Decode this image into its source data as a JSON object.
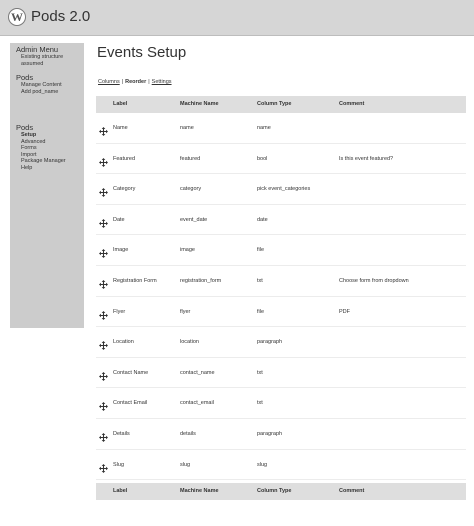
{
  "app": {
    "title": "Pods 2.0",
    "logo_letter": "W"
  },
  "sidebar": {
    "groups": [
      {
        "heading": "Admin Menu",
        "items": [
          {
            "label": "Existing structure"
          },
          {
            "label": "assumed"
          }
        ]
      },
      {
        "heading": "Pods",
        "items": [
          {
            "label": "Manage Content"
          },
          {
            "label": "Add pod_name"
          }
        ]
      },
      {
        "heading": "Pods",
        "items": [
          {
            "label": "Setup",
            "active": true
          },
          {
            "label": "Advanced"
          },
          {
            "label": "Forms"
          },
          {
            "label": "Import"
          },
          {
            "label": "Package Manager"
          },
          {
            "label": "Help"
          }
        ]
      }
    ]
  },
  "page": {
    "title": "Events Setup"
  },
  "subnav": {
    "columns": "Columns",
    "reorder": "Reorder",
    "settings": "Settings",
    "separator": "|"
  },
  "table": {
    "headers": {
      "label": "Label",
      "machine": "Machine Name",
      "type": "Column Type",
      "comment": "Comment"
    },
    "rows": [
      {
        "label": "Name",
        "machine": "name",
        "type": "name",
        "comment": ""
      },
      {
        "label": "Featured",
        "machine": "featured",
        "type": "bool",
        "comment": "Is this event featured?"
      },
      {
        "label": "Category",
        "machine": "category",
        "type": "pick event_categories",
        "comment": ""
      },
      {
        "label": "Date",
        "machine": "event_date",
        "type": "date",
        "comment": ""
      },
      {
        "label": "Image",
        "machine": "image",
        "type": "file",
        "comment": ""
      },
      {
        "label": "Registration Form",
        "machine": "registration_form",
        "type": "txt",
        "comment": "Choose form from dropdown"
      },
      {
        "label": "Flyer",
        "machine": "flyer",
        "type": "file",
        "comment": "PDF"
      },
      {
        "label": "Location",
        "machine": "location",
        "type": "paragraph",
        "comment": ""
      },
      {
        "label": "Contact Name",
        "machine": "contact_name",
        "type": "txt",
        "comment": ""
      },
      {
        "label": "Contact Email",
        "machine": "contact_email",
        "type": "txt",
        "comment": ""
      },
      {
        "label": "Details",
        "machine": "details",
        "type": "paragraph",
        "comment": ""
      },
      {
        "label": "Slug",
        "machine": "slug",
        "type": "slug",
        "comment": ""
      }
    ]
  },
  "icons": {
    "logo": "wordpress-logo-icon",
    "row_handle": "drag-move-icon"
  },
  "colors": {
    "header_bg": "#d6d6d6",
    "sidebar_bg": "#cccccc",
    "table_head_bg": "#dedede"
  }
}
